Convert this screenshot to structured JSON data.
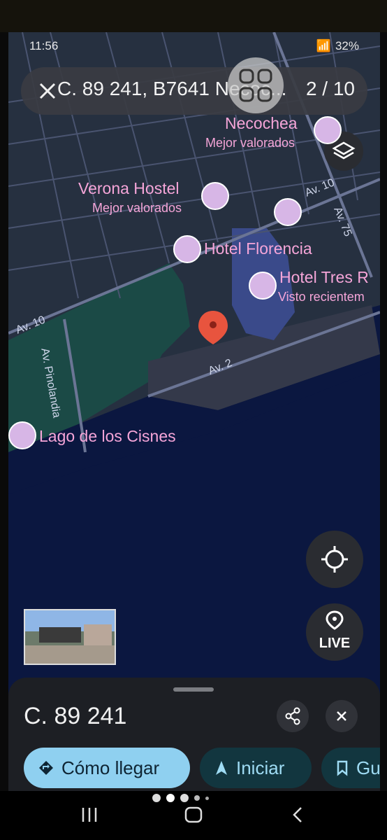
{
  "status_bar": {
    "time": "11:56",
    "battery": "32%"
  },
  "search": {
    "query": "C. 89 241, B7641 Necoc...",
    "result_counter": "2 / 10"
  },
  "map": {
    "streets": [
      "Av. 10",
      "Av. 75",
      "Av. 10",
      "Av. Pinolandia",
      "Av. 2"
    ],
    "pois": [
      {
        "name": "Necochea",
        "subtitle": "Mejor valorados"
      },
      {
        "name": "Verona Hostel",
        "subtitle": "Mejor valorados"
      },
      {
        "name": "Hotel Florencia",
        "subtitle": ""
      },
      {
        "name": "Hotel Tres R",
        "subtitle": "Visto recientem"
      },
      {
        "name": "Lago de los Cisnes",
        "subtitle": ""
      }
    ]
  },
  "controls": {
    "live_label": "LIVE"
  },
  "sheet": {
    "title": "C. 89 241",
    "actions": [
      {
        "label": "Cómo llegar"
      },
      {
        "label": "Iniciar"
      },
      {
        "label": "Gu"
      }
    ]
  },
  "colors": {
    "accent_chip": "#8fd0f0",
    "poi_text": "#f5a5d8",
    "pin_red": "#e8543e"
  }
}
